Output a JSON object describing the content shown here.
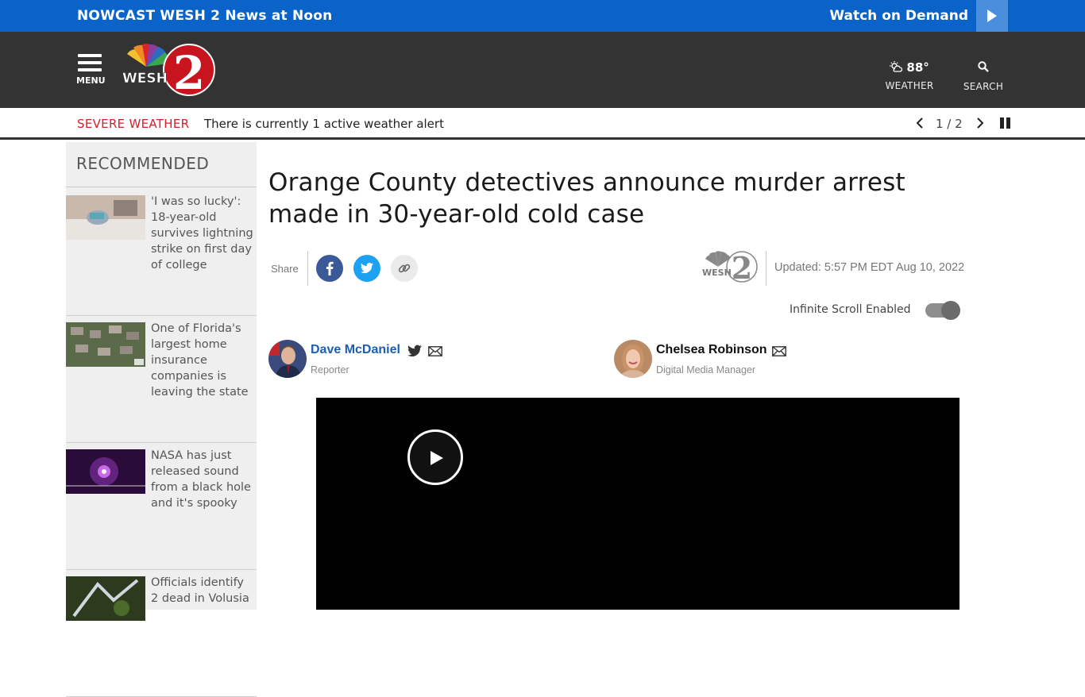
{
  "topbar": {
    "nowcast": "NOWCAST WESH 2 News at Noon",
    "watch_on_demand": "Watch on Demand"
  },
  "header": {
    "menu_label": "MENU",
    "logo_text": "WESH",
    "logo_number": "2",
    "temperature": "88°",
    "weather_label": "WEATHER",
    "search_label": "SEARCH"
  },
  "alert": {
    "label": "SEVERE WEATHER",
    "message": "There is currently 1 active weather alert",
    "counter": "1 / 2"
  },
  "sidebar": {
    "title": "RECOMMENDED",
    "items": [
      {
        "text": "'I was so lucky': 18-year-old survives lightning strike on first day of college"
      },
      {
        "text": "One of Florida's largest home insurance companies is leaving the state"
      },
      {
        "text": "NASA has just released sound from a black hole and it's spooky"
      },
      {
        "text": "Officials identify 2 dead in Volusia"
      }
    ]
  },
  "article": {
    "title": "Orange County detectives announce murder arrest made in 30-year-old cold case",
    "share_label": "Share",
    "updated": "Updated: 5:57 PM EDT Aug 10, 2022",
    "infinite_scroll_label": "Infinite Scroll Enabled",
    "infinite_scroll_enabled": true,
    "authors": [
      {
        "name": "Dave McDaniel",
        "role": "Reporter"
      },
      {
        "name": "Chelsea Robinson",
        "role": "Digital Media Manager"
      }
    ]
  },
  "colors": {
    "topbar": "#0a63c9",
    "header": "#333333",
    "severe": "#d4202b",
    "author_link": "#1a5fb4",
    "facebook": "#3b5998",
    "twitter": "#1da1f2"
  }
}
